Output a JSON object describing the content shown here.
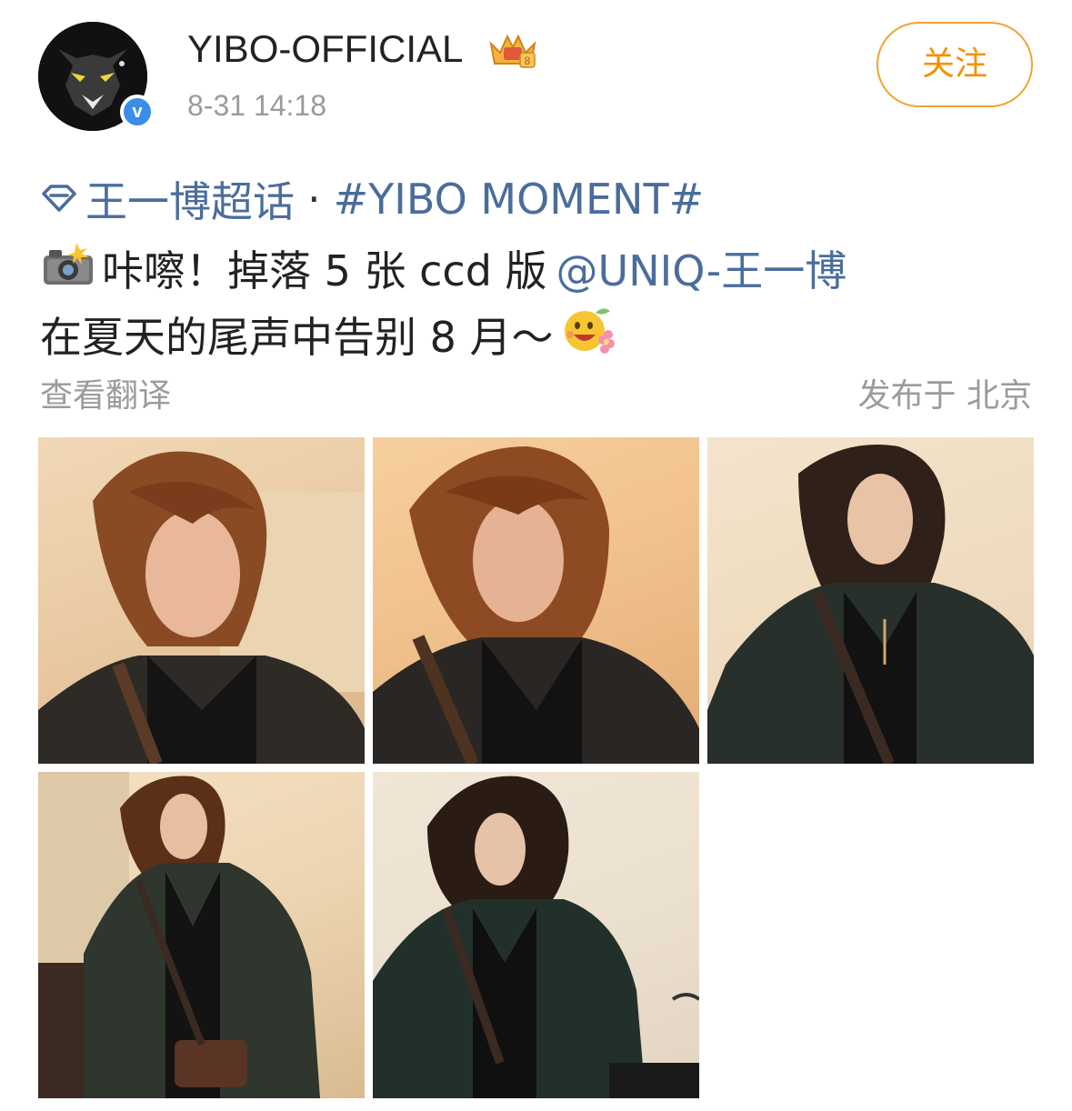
{
  "user": {
    "name": "YIBO-OFFICIAL",
    "timestamp": "8-31 14:18",
    "verified_badge": "v",
    "avatar_icon": "panther-avatar",
    "badge_icon": "crown-vip-icon"
  },
  "follow_button": {
    "label": "关注"
  },
  "post": {
    "topic": "王一博超话",
    "separator": "·",
    "hashtag": "#YIBO MOMENT#",
    "line1_emoji": "camera-flash-emoji",
    "line1_text": "咔嚓！掉落 5 张 ccd 版",
    "mention": "@UNIQ-王一博",
    "line2_text": "在夏天的尾声中告别 8 月～",
    "line2_emoji": "flower-smile-emoji"
  },
  "translate_link": "查看翻译",
  "location": "发布于 北京",
  "photos": [
    {
      "id": "photo-1"
    },
    {
      "id": "photo-2"
    },
    {
      "id": "photo-3"
    },
    {
      "id": "photo-4"
    },
    {
      "id": "photo-5"
    }
  ],
  "colors": {
    "link": "#4a6d9c",
    "follow": "#f29100",
    "meta": "#9b9b9b",
    "verify": "#3a8ee6"
  }
}
